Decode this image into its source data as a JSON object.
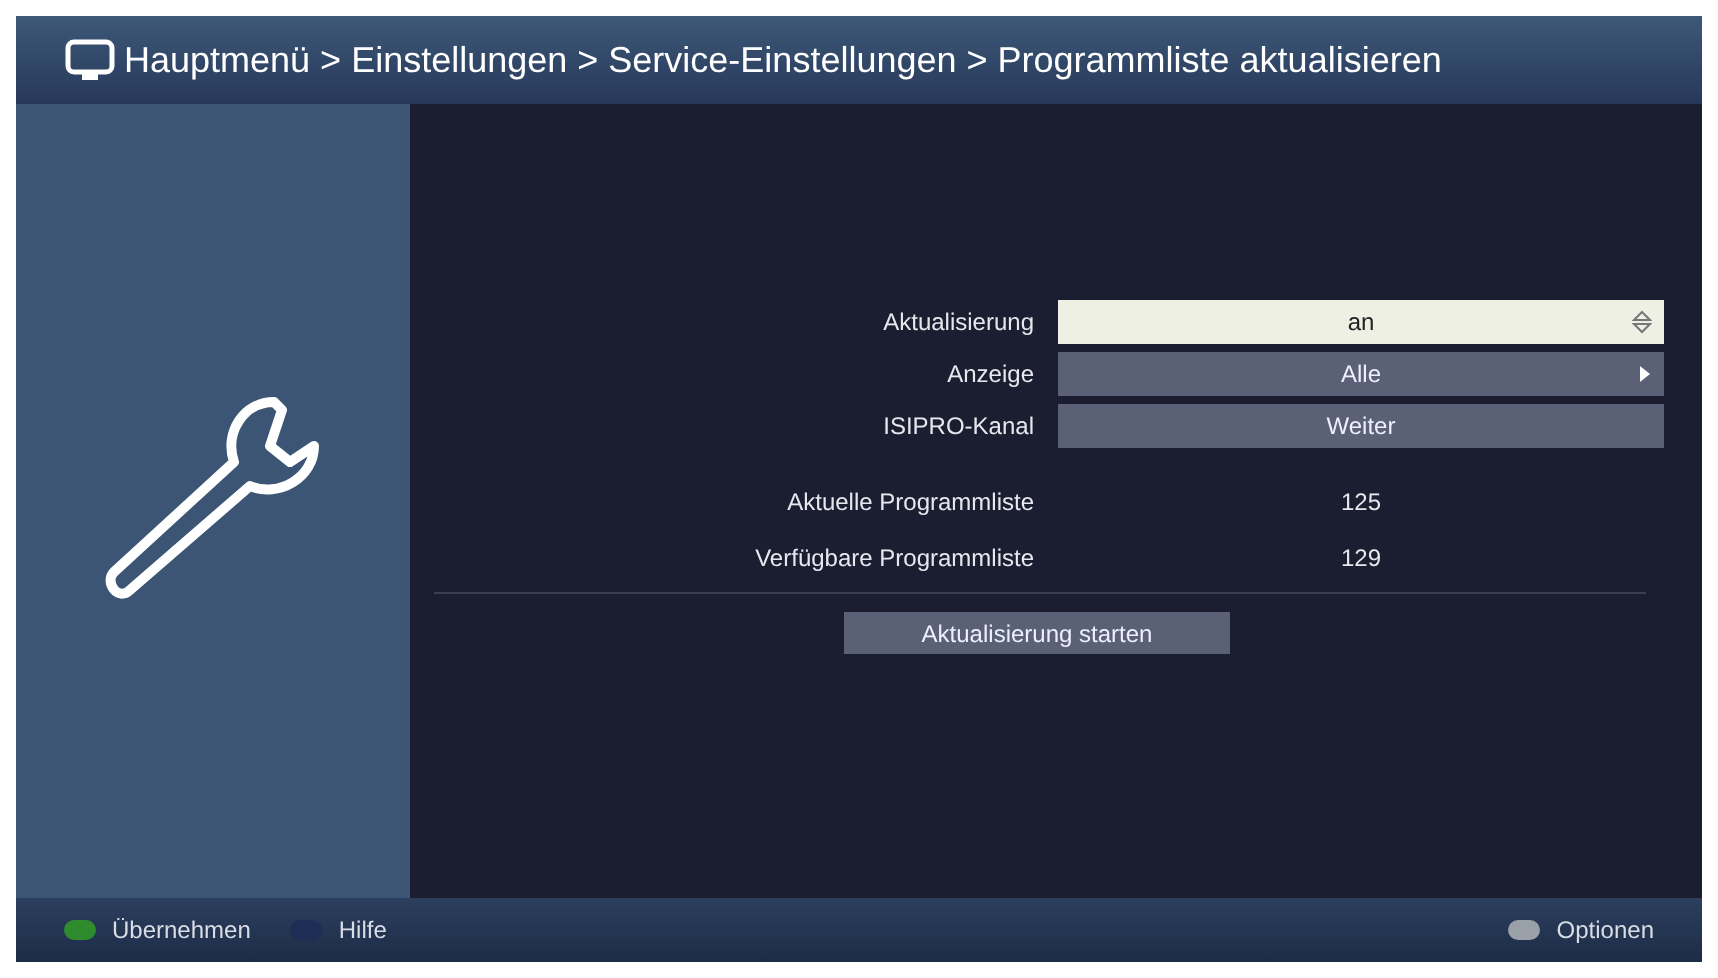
{
  "header": {
    "title": "Hauptmenü > Einstellungen > Service-Einstellungen > Programmliste aktualisieren"
  },
  "settings": [
    {
      "label": "Aktualisierung",
      "value": "an",
      "kind": "updown",
      "selected": true
    },
    {
      "label": "Anzeige",
      "value": "Alle",
      "kind": "arrow",
      "selected": false
    },
    {
      "label": "ISIPRO-Kanal",
      "value": "Weiter",
      "kind": "plain",
      "selected": false
    }
  ],
  "info": [
    {
      "label": "Aktuelle Programmliste",
      "value": "125"
    },
    {
      "label": "Verfügbare Programmliste",
      "value": "129"
    }
  ],
  "action": {
    "label": "Aktualisierung starten"
  },
  "footer": {
    "left": [
      {
        "label": "Übernehmen",
        "color": "#2e8b2e"
      },
      {
        "label": "Hilfe",
        "color": "#1e2d55"
      }
    ],
    "right": [
      {
        "label": "Optionen",
        "color": "#9aa0a8"
      }
    ]
  }
}
